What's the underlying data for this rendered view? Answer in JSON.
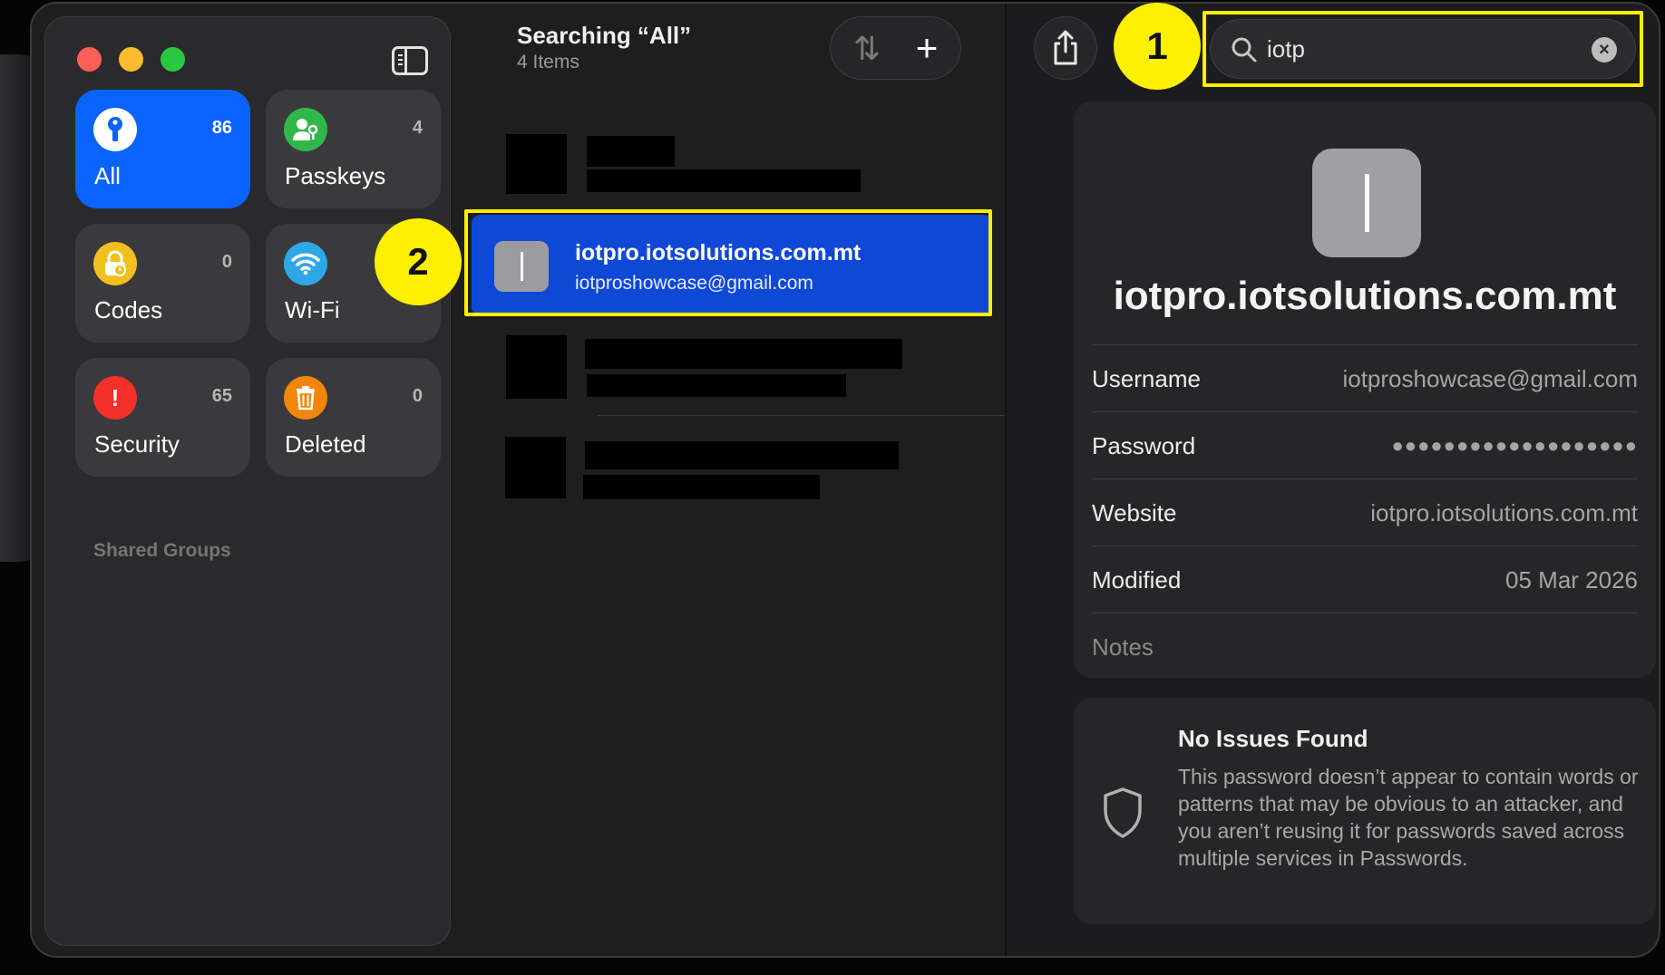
{
  "sidebar": {
    "cards": [
      {
        "label": "All",
        "count": "86",
        "icon": "key-icon",
        "color": "#0a63ff",
        "active": true
      },
      {
        "label": "Passkeys",
        "count": "4",
        "icon": "person-key-icon",
        "color": "#2fb84a",
        "active": false
      },
      {
        "label": "Codes",
        "count": "0",
        "icon": "lock-clock-icon",
        "color": "#f2c01e",
        "active": false
      },
      {
        "label": "Wi-Fi",
        "count": "",
        "icon": "wifi-icon",
        "color": "#2ea7e6",
        "active": false
      },
      {
        "label": "Security",
        "count": "65",
        "icon": "exclamation-icon",
        "color": "#f2312a",
        "active": false
      },
      {
        "label": "Deleted",
        "count": "0",
        "icon": "trash-icon",
        "color": "#f2860a",
        "active": false
      }
    ],
    "shared_groups_label": "Shared Groups"
  },
  "list": {
    "title": "Searching “All”",
    "subtitle": "4 Items",
    "selected_item": {
      "title": "iotpro.iotsolutions.com.mt",
      "subtitle": "iotproshowcase@gmail.com"
    }
  },
  "detail": {
    "search_value": "iotp",
    "title": "iotpro.iotsolutions.com.mt",
    "fields": [
      {
        "label": "Username",
        "value": "iotproshowcase@gmail.com"
      },
      {
        "label": "Password",
        "value": "●●●●●●●●●●●●●●●●●●●"
      },
      {
        "label": "Website",
        "value": "iotpro.iotsolutions.com.mt"
      },
      {
        "label": "Modified",
        "value": "05 Mar 2026"
      }
    ],
    "notes_label": "Notes",
    "security": {
      "title": "No Issues Found",
      "body": "This password doesn’t appear to contain words or patterns that may be obvious to an attacker, and you aren’t reusing it for passwords saved across multiple services in Passwords."
    }
  },
  "annotations": {
    "badge1": "1",
    "badge2": "2"
  }
}
